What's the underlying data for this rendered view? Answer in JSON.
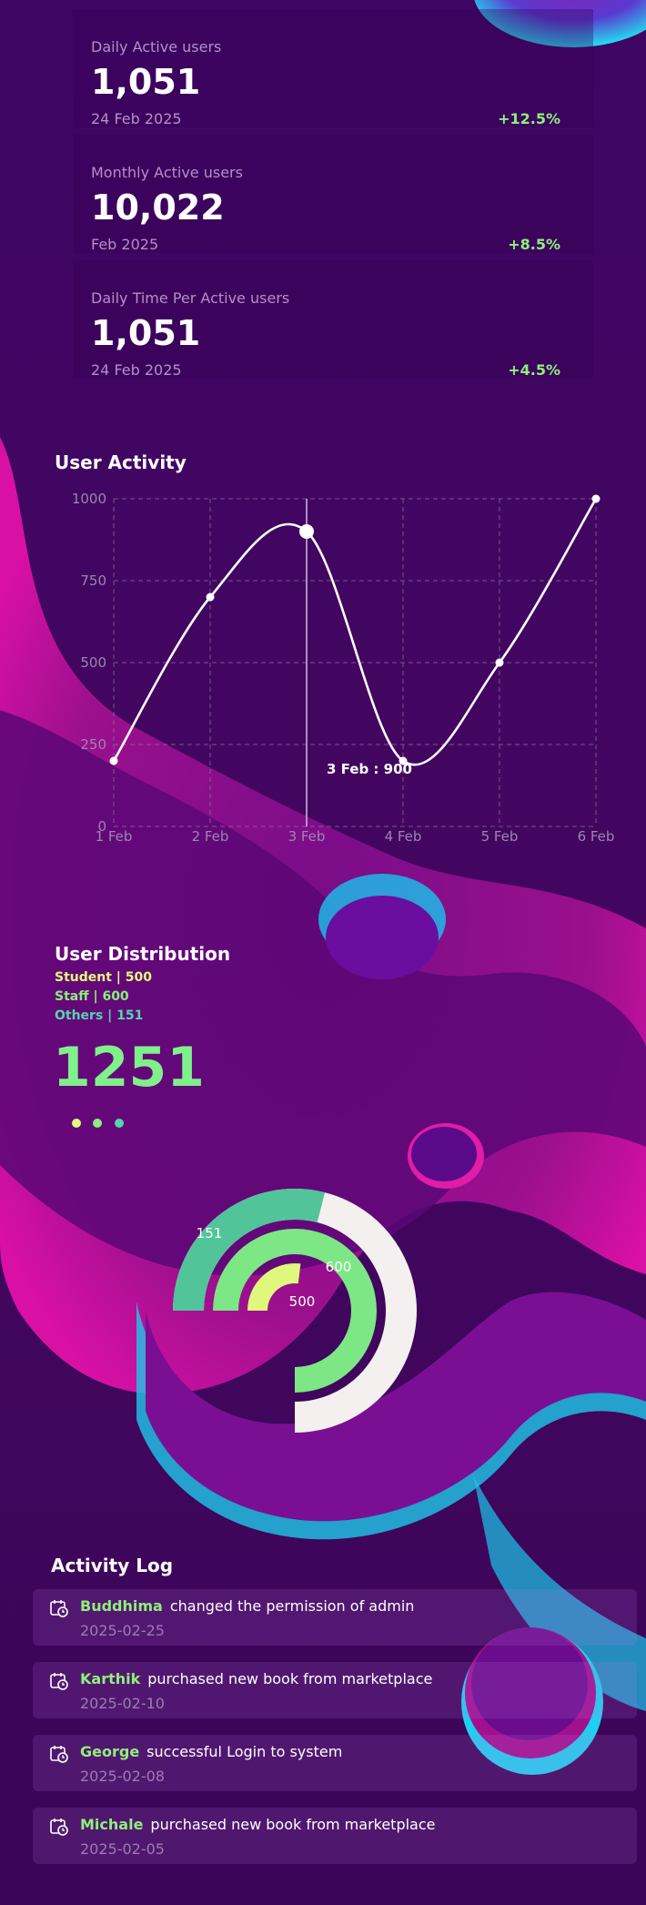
{
  "stats": [
    {
      "label": "Daily Active users",
      "value": "1,051",
      "date": "24 Feb 2025",
      "change": "+12.5%"
    },
    {
      "label": "Monthly Active users",
      "value": "10,022",
      "date": "Feb 2025",
      "change": "+8.5%"
    },
    {
      "label": "Daily Time Per Active users",
      "value": "1,051",
      "date": "24 Feb 2025",
      "change": "+4.5%"
    }
  ],
  "user_activity": {
    "title": "User Activity",
    "tooltip": "3 Feb : 900"
  },
  "user_distribution": {
    "title": "User Distribution",
    "legend": [
      {
        "name": "Student",
        "value": "500"
      },
      {
        "name": "Staff",
        "value": "600"
      },
      {
        "name": "Others",
        "value": "151"
      }
    ],
    "total": "1251",
    "dot_colors": [
      "#e4fa7a",
      "#8af07a",
      "#52d6a8"
    ]
  },
  "activity_log": {
    "title": "Activity Log",
    "items": [
      {
        "user": "Buddhima",
        "action": "changed the permission of admin",
        "date": "2025-02-25"
      },
      {
        "user": "Karthik",
        "action": "purchased new book from marketplace",
        "date": "2025-02-10"
      },
      {
        "user": "George",
        "action": "successful Login to system",
        "date": "2025-02-08"
      },
      {
        "user": "Michale",
        "action": "purchased new book from marketplace",
        "date": "2025-02-05"
      }
    ]
  },
  "colors": {
    "accent_green": "#8ff07a",
    "student": "#e4fa7a",
    "staff": "#7de685",
    "others": "#52c49a",
    "background": "#3b0560"
  },
  "chart_data": [
    {
      "type": "line",
      "title": "User Activity",
      "categories": [
        "1 Feb",
        "2 Feb",
        "3 Feb",
        "4 Feb",
        "5 Feb",
        "6 Feb"
      ],
      "series": [
        {
          "values": [
            200,
            700,
            900,
            200,
            500,
            1000
          ]
        }
      ],
      "yticks": [
        0,
        250,
        500,
        750,
        1000
      ],
      "ylim": [
        0,
        1000
      ],
      "grid": true,
      "annotations": [
        {
          "x": "3 Feb",
          "text": "3 Feb : 900"
        }
      ]
    },
    {
      "type": "pie",
      "title": "User Distribution",
      "categories": [
        "Student",
        "Staff",
        "Others"
      ],
      "values": [
        500,
        600,
        151
      ],
      "total": 1251
    }
  ]
}
